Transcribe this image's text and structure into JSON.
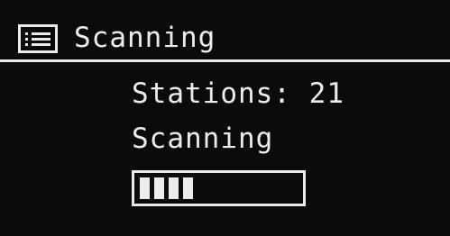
{
  "header": {
    "icon": "menu-list-icon",
    "title": "Scanning"
  },
  "scan": {
    "stations_label": "Stations:",
    "stations_count": "21",
    "status": "Scanning",
    "progress_segments_filled": 4,
    "progress_fraction": 0.38
  },
  "colors": {
    "background": "#0b0b0b",
    "foreground": "#ececec"
  }
}
